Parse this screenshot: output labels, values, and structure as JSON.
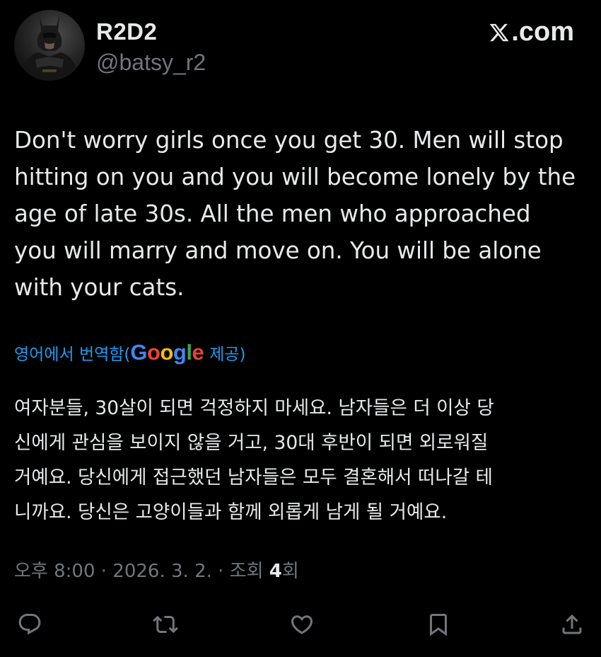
{
  "header": {
    "display_name": "R2D2",
    "handle": "@batsy_r2",
    "site": ".com"
  },
  "tweet": {
    "lines": [
      "Don't worry girls once you get 30. Men will stop",
      "hitting on you and you will become lonely by the",
      "age of late 30s. All the men who approached",
      "you will marry and move on. You will be alone",
      "with your cats."
    ]
  },
  "translation": {
    "prefix": "영어에서 번역함(",
    "provider_letters": [
      "G",
      "o",
      "o",
      "g",
      "l",
      "e"
    ],
    "suffix": " 제공)",
    "lines": [
      "여자분들, 30살이 되면 걱정하지 마세요. 남자들은 더 이상 당",
      "신에게 관심을 보이지 않을 거고, 30대 후반이 되면 외로워질",
      "거예요. 당신에게 접근했던 남자들은 모두 결혼해서 떠나갈 테",
      "니까요. 당신은 고양이들과 함께 외롭게 남게 될 거예요."
    ]
  },
  "meta": {
    "time": "오후 8:00",
    "date": "2026. 3. 2.",
    "views_label": "조회",
    "views_count": "4",
    "views_suffix": "회"
  },
  "actions": [
    {
      "name": "reply",
      "icon": "reply-icon"
    },
    {
      "name": "repost",
      "icon": "repost-icon"
    },
    {
      "name": "like",
      "icon": "heart-icon"
    },
    {
      "name": "bookmark",
      "icon": "bookmark-icon"
    },
    {
      "name": "share",
      "icon": "share-icon"
    }
  ],
  "colors": {
    "background": "#000000",
    "text": "#e7e9ea",
    "secondary": "#71767b",
    "link": "#1d9bf0"
  }
}
